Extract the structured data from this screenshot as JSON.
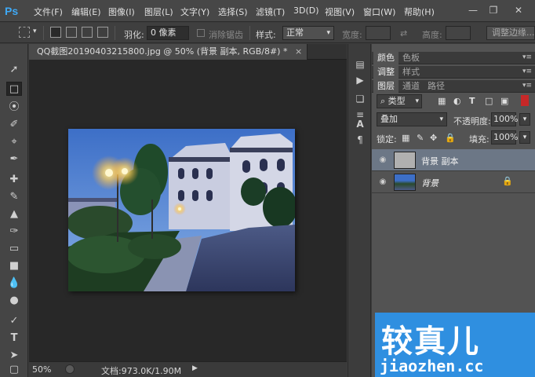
{
  "app": {
    "logo": "Ps"
  },
  "menubar": {
    "items": [
      "文件(F)",
      "编辑(E)",
      "图像(I)",
      "图层(L)",
      "文字(Y)",
      "选择(S)",
      "滤镜(T)",
      "3D(D)",
      "视图(V)",
      "窗口(W)",
      "帮助(H)"
    ],
    "window_buttons": [
      "minimize-icon",
      "restore-icon",
      "close-icon"
    ]
  },
  "options_bar": {
    "feather_label": "羽化:",
    "feather_value": "0 像素",
    "antialias_label": "消除锯齿",
    "style_label": "样式:",
    "style_value": "正常",
    "width_label": "宽度:",
    "height_label": "高度:",
    "refine_edge_button": "调整边缘..."
  },
  "document": {
    "tab_title": "QQ截图20190403215800.jpg @ 50% (背景 副本, RGB/8#) *",
    "zoom": "50%",
    "doc_info": "文档:973.0K/1.90M"
  },
  "panels": {
    "top_tabs": [
      "颜色",
      "色板"
    ],
    "adjust_tabs": [
      "调整",
      "样式"
    ],
    "layer_tabs": [
      "图层",
      "通道",
      "路径"
    ],
    "filter_kind": "类型",
    "blend_mode": "叠加",
    "opacity_label": "不透明度:",
    "opacity_value": "100%",
    "lock_label": "锁定:",
    "fill_label": "填充:",
    "fill_value": "100%",
    "layers": [
      {
        "name": "背景 副本",
        "selected": true
      },
      {
        "name": "背景",
        "locked": true
      }
    ]
  },
  "watermark": {
    "title": "较真儿",
    "url": "jiaozhen.cc"
  }
}
